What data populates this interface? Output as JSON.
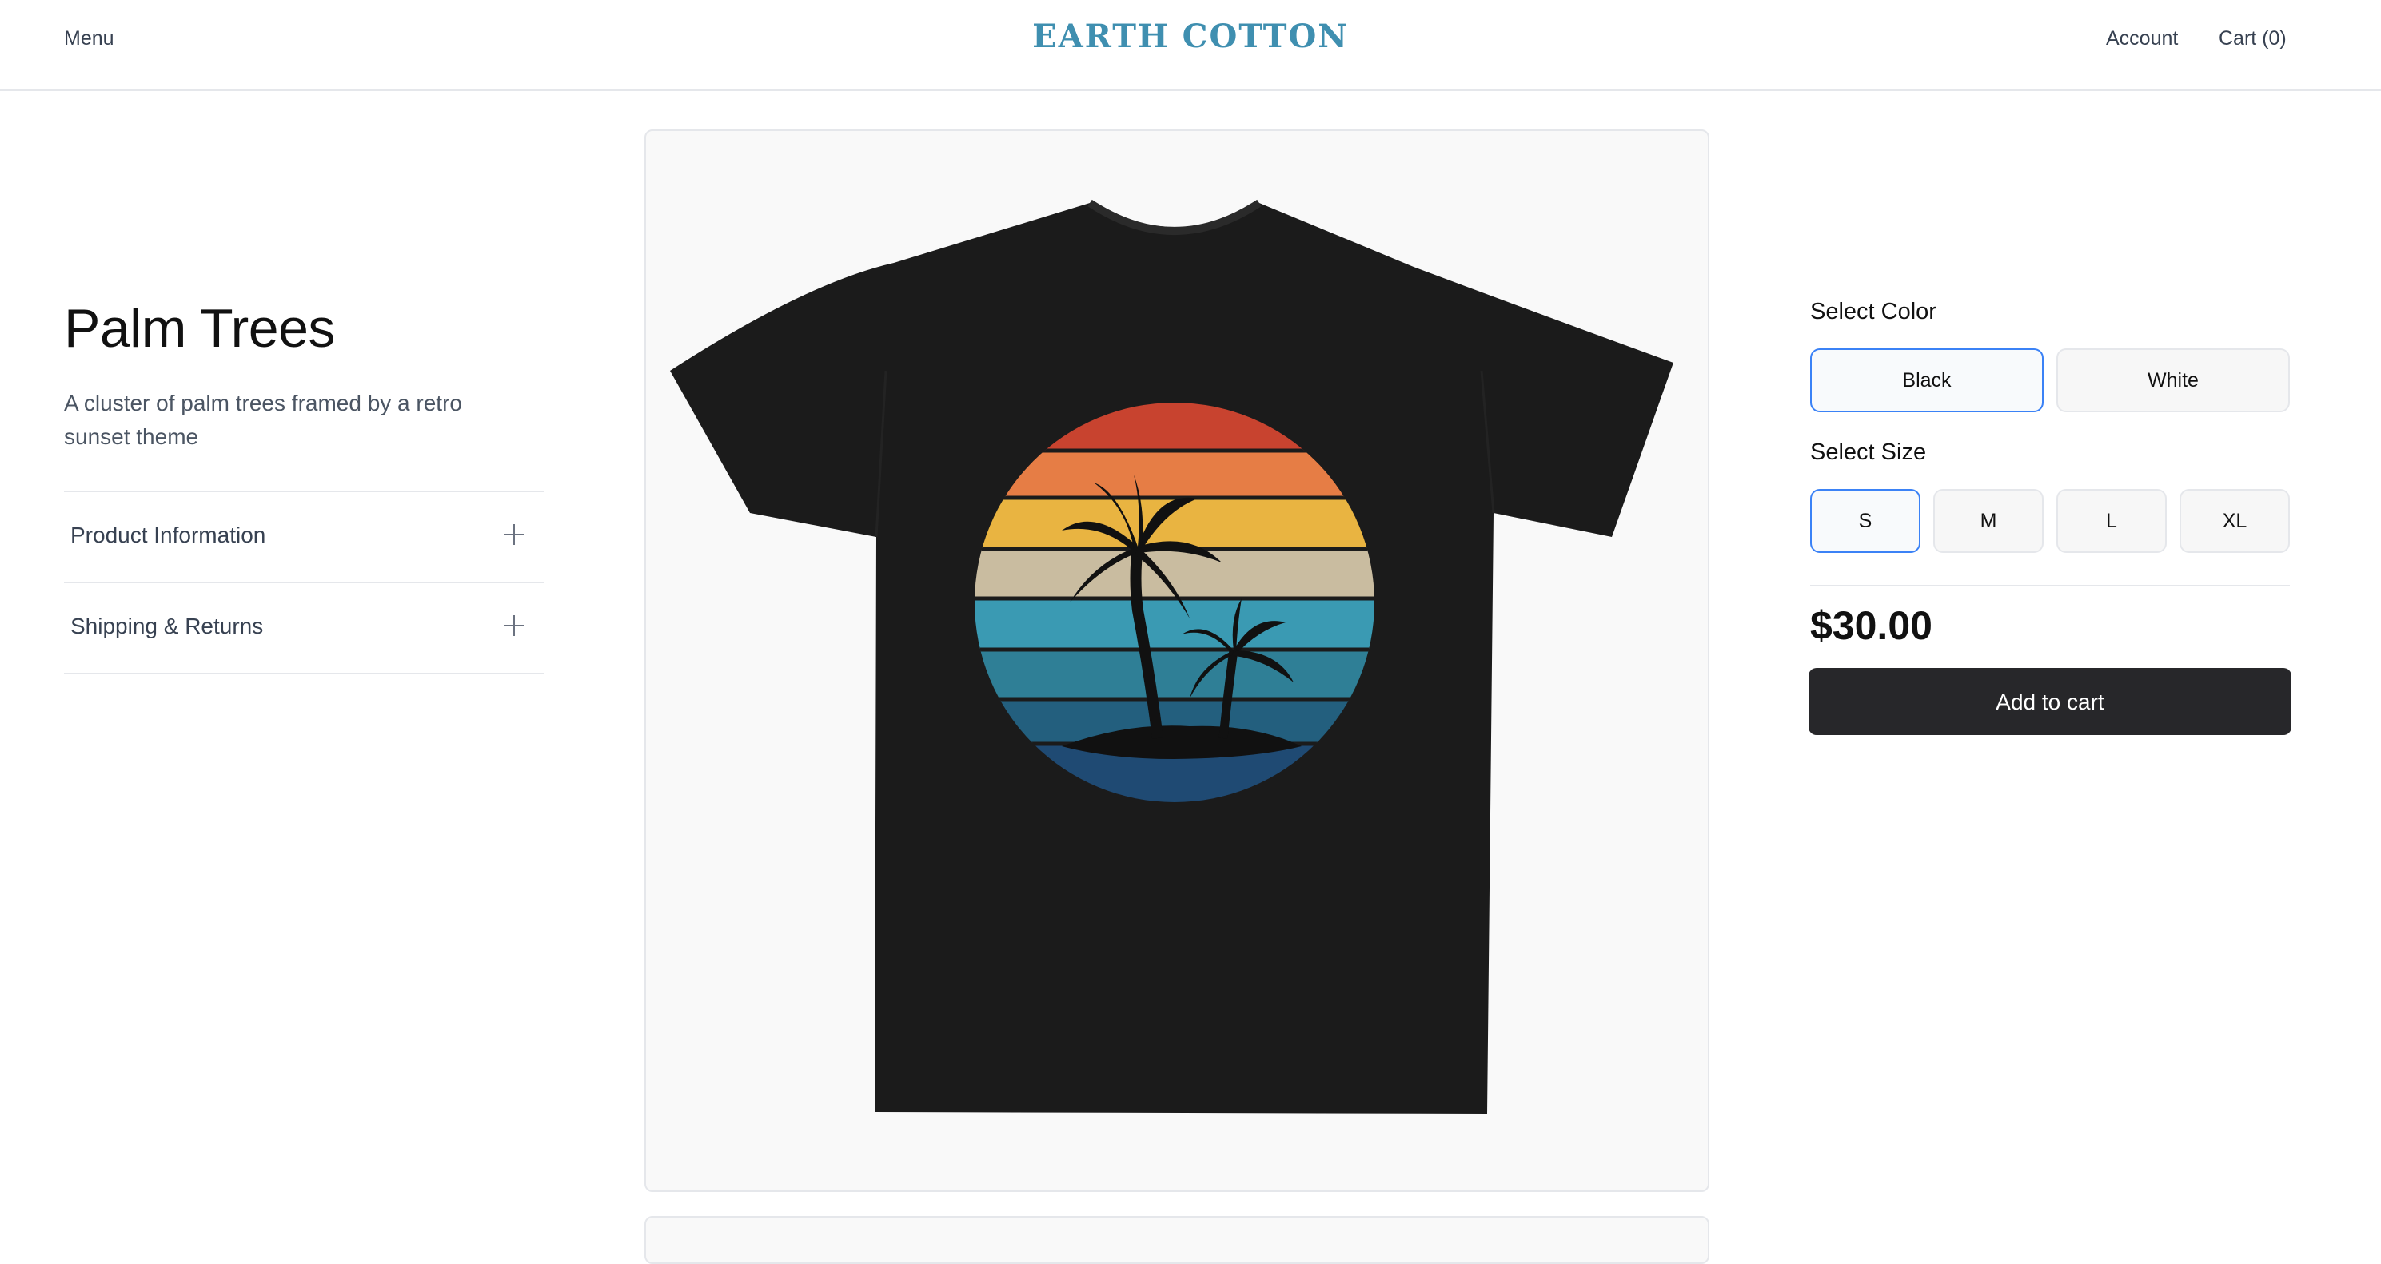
{
  "header": {
    "menu_label": "Menu",
    "brand": "EARTH COTTON",
    "account_label": "Account",
    "cart_label": "Cart (0)"
  },
  "product": {
    "title": "Palm Trees",
    "description": "A cluster of palm trees framed by a retro sunset theme",
    "accordion": [
      {
        "label": "Product Information",
        "icon": "plus-icon"
      },
      {
        "label": "Shipping & Returns",
        "icon": "plus-icon"
      }
    ],
    "image": {
      "subject": "black t-shirt with retro sunset palm tree graphic",
      "shirt_color": "#1b1b1b",
      "stripe_colors": [
        "#c8432f",
        "#e67d45",
        "#e9b441",
        "#c9bca0",
        "#3a9ab3",
        "#2f7f96",
        "#235f7e",
        "#1f4a73"
      ]
    }
  },
  "options": {
    "color_label": "Select Color",
    "colors": [
      {
        "label": "Black",
        "selected": true
      },
      {
        "label": "White",
        "selected": false
      }
    ],
    "size_label": "Select Size",
    "sizes": [
      {
        "label": "S",
        "selected": true
      },
      {
        "label": "M",
        "selected": false
      },
      {
        "label": "L",
        "selected": false
      },
      {
        "label": "XL",
        "selected": false
      }
    ]
  },
  "price": "$30.00",
  "add_to_cart_label": "Add to cart",
  "theme": {
    "brand_color": "#3f8fb0",
    "selected_border": "#3b82f6",
    "button_bg": "#27272a"
  }
}
